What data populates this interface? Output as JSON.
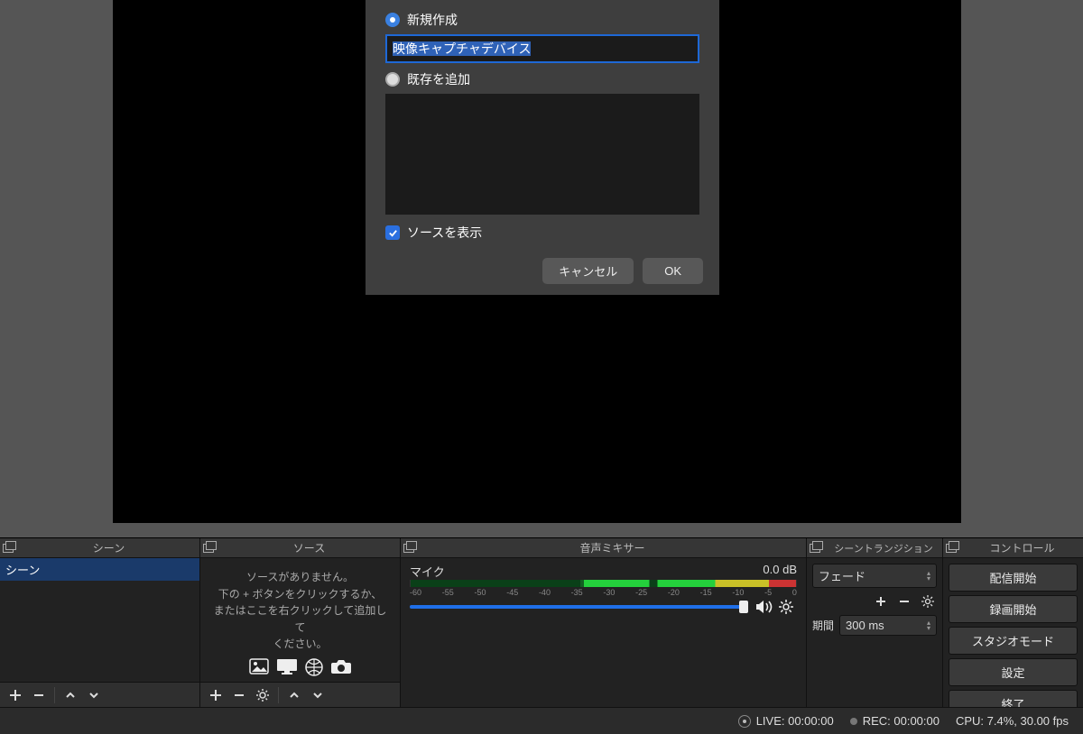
{
  "dialog": {
    "create_new_label": "新規作成",
    "name_value": "映像キャプチャデバイス",
    "add_existing_label": "既存を追加",
    "show_source_label": "ソースを表示",
    "cancel_label": "キャンセル",
    "ok_label": "OK"
  },
  "docks": {
    "scenes": {
      "title": "シーン",
      "items": [
        "シーン"
      ]
    },
    "sources": {
      "title": "ソース",
      "empty_line1": "ソースがありません。",
      "empty_line2": "下の + ボタンをクリックするか、",
      "empty_line3": "またはここを右クリックして追加して",
      "empty_line4": "ください。"
    },
    "mixer": {
      "title": "音声ミキサー",
      "channel_name": "マイク",
      "level_db": "0.0 dB",
      "ticks": [
        "-60",
        "-55",
        "-50",
        "-45",
        "-40",
        "-35",
        "-30",
        "-25",
        "-20",
        "-15",
        "-10",
        "-5",
        "0"
      ]
    },
    "transitions": {
      "title": "シーントランジション",
      "selected": "フェード",
      "duration_label": "期間",
      "duration_value": "300 ms"
    },
    "controls": {
      "title": "コントロール",
      "buttons": [
        "配信開始",
        "録画開始",
        "スタジオモード",
        "設定",
        "終了"
      ]
    }
  },
  "status": {
    "live_label": "LIVE: 00:00:00",
    "rec_label": "REC: 00:00:00",
    "cpu_label": "CPU: 7.4%, 30.00 fps"
  }
}
